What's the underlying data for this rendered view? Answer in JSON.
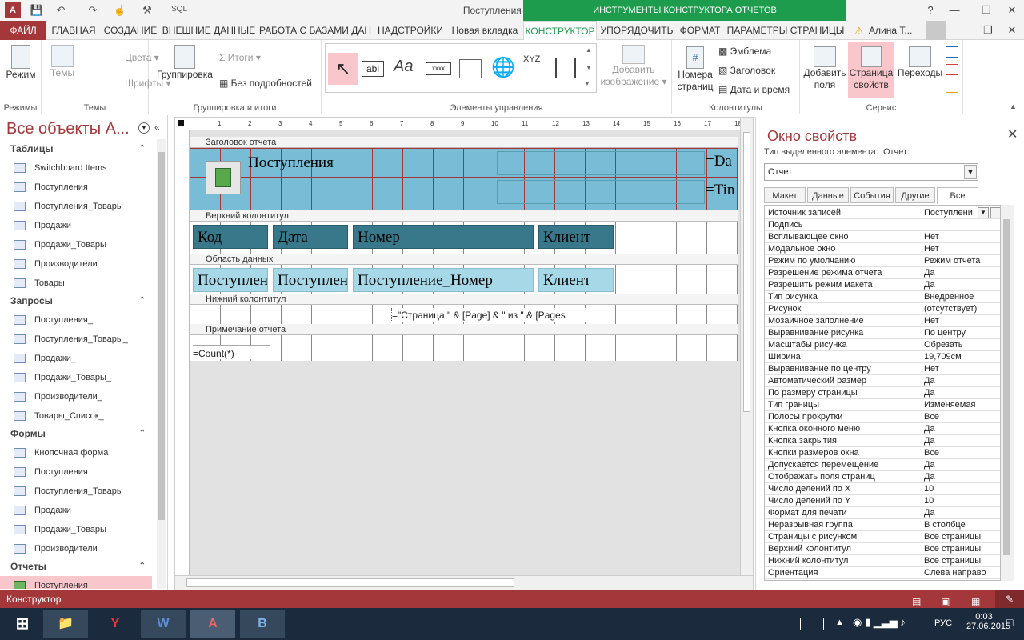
{
  "app": {
    "title": "Поступления - Access",
    "context_group": "ИНСТРУМЕНТЫ КОНСТРУКТОРА ОТЧЕТОВ",
    "qat_sql": "SQL",
    "user": "Алина Т..."
  },
  "tabs": [
    {
      "label": "ФАЙЛ"
    },
    {
      "label": "ГЛАВНАЯ"
    },
    {
      "label": "СОЗДАНИЕ"
    },
    {
      "label": "ВНЕШНИЕ ДАННЫЕ"
    },
    {
      "label": "РАБОТА С БАЗАМИ ДАН"
    },
    {
      "label": "НАДСТРОЙКИ"
    },
    {
      "label": "Новая вкладка"
    },
    {
      "label": "КОНСТРУКТОР"
    },
    {
      "label": "УПОРЯДОЧИТЬ"
    },
    {
      "label": "ФОРМАТ"
    },
    {
      "label": "ПАРАМЕТРЫ СТРАНИЦЫ"
    }
  ],
  "ribbon": {
    "groups": {
      "views": "Режимы",
      "themes": "Темы",
      "grouping": "Группировка и итоги",
      "controls": "Элементы управления",
      "headers": "Колонтитулы",
      "tools": "Сервис"
    },
    "view": "Режим",
    "themes": "Темы",
    "colors": "Цвета",
    "fonts": "Шрифты",
    "grouping": "Группировка",
    "totals": "Итоги",
    "no_details": "Без подробностей",
    "add_image": [
      "Добавить",
      "изображение"
    ],
    "page_numbers": [
      "Номера",
      "страниц"
    ],
    "logo": "Эмблема",
    "title": "Заголовок",
    "datetime": "Дата и время",
    "add_fields": [
      "Добавить",
      "поля"
    ],
    "property_sheet": [
      "Страница",
      "свойств"
    ],
    "transitions": "Переходы",
    "ctrl_label": "XYZ",
    "ctrl_text": "abl",
    "ctrl_aa": "Aa",
    "ctrl_xxxx": "xxxx"
  },
  "nav": {
    "title": "Все объекты А...",
    "sections": [
      {
        "name": "Таблицы",
        "items": [
          "Switchboard Items",
          "Поступления",
          "Поступления_Товары",
          "Продажи",
          "Продажи_Товары",
          "Производители",
          "Товары"
        ]
      },
      {
        "name": "Запросы",
        "items": [
          "Поступления_",
          "Поступления_Товары_",
          "Продажи_",
          "Продажи_Товары_",
          "Производители_",
          "Товары_Список_"
        ]
      },
      {
        "name": "Формы",
        "items": [
          "Кнопочная форма",
          "Поступления",
          "Поступления_Товары",
          "Продажи",
          "Продажи_Товары",
          "Производители"
        ]
      },
      {
        "name": "Отчеты",
        "items": [
          "Поступления"
        ]
      }
    ]
  },
  "designer": {
    "ruler_marks": [
      "1",
      "2",
      "3",
      "4",
      "5",
      "6",
      "7",
      "8",
      "9",
      "10",
      "11",
      "12",
      "13",
      "14",
      "15",
      "16",
      "17",
      "18"
    ],
    "bands": [
      "Заголовок отчета",
      "Верхний колонтитул",
      "Область данных",
      "Нижний колонтитул",
      "Примечание отчета"
    ],
    "report_title": "Поступления",
    "date_expr": "=Da",
    "time_expr": "=Tin",
    "headers": [
      "Код",
      "Дата",
      "Номер",
      "Клиент"
    ],
    "data_fields": [
      "Поступлен",
      "Поступлен",
      "Поступление_Номер",
      "Клиент"
    ],
    "page_expr": "=\"Страница \" & [Page] & \" из \" & [Pages",
    "count_expr": "=Count(*)"
  },
  "props": {
    "title": "Окно свойств",
    "selection_type_label": "Тип выделенного элемента:",
    "selection_type": "Отчет",
    "selected": "Отчет",
    "tabs": [
      "Макет",
      "Данные",
      "События",
      "Другие",
      "Все"
    ],
    "rows": [
      [
        "Источник записей",
        "Поступлени"
      ],
      [
        "Подпись",
        ""
      ],
      [
        "Всплывающее окно",
        "Нет"
      ],
      [
        "Модальное окно",
        "Нет"
      ],
      [
        "Режим по умолчанию",
        "Режим отчета"
      ],
      [
        "Разрешение режима отчета",
        "Да"
      ],
      [
        "Разрешить режим макета",
        "Да"
      ],
      [
        "Тип рисунка",
        "Внедренное"
      ],
      [
        "Рисунок",
        "(отсутствует)"
      ],
      [
        "Мозаичное заполнение",
        "Нет"
      ],
      [
        "Выравнивание рисунка",
        "По центру"
      ],
      [
        "Масштабы рисунка",
        "Обрезать"
      ],
      [
        "Ширина",
        "19,709см"
      ],
      [
        "Выравнивание по центру",
        "Нет"
      ],
      [
        "Автоматический размер",
        "Да"
      ],
      [
        "По размеру страницы",
        "Да"
      ],
      [
        "Тип границы",
        "Изменяемая"
      ],
      [
        "Полосы прокрутки",
        "Все"
      ],
      [
        "Кнопка оконного меню",
        "Да"
      ],
      [
        "Кнопка закрытия",
        "Да"
      ],
      [
        "Кнопки размеров окна",
        "Все"
      ],
      [
        "Допускается перемещение",
        "Да"
      ],
      [
        "Отображать поля страниц",
        "Да"
      ],
      [
        "Число делений по X",
        "10"
      ],
      [
        "Число делений по Y",
        "10"
      ],
      [
        "Формат для печати",
        "Да"
      ],
      [
        "Неразрывная группа",
        "В столбце"
      ],
      [
        "Страницы с рисунком",
        "Все страницы"
      ],
      [
        "Верхний колонтитул",
        "Все страницы"
      ],
      [
        "Нижний колонтитул",
        "Все страницы"
      ],
      [
        "Ориентация",
        "Слева направо"
      ]
    ]
  },
  "status": {
    "text": "Конструктор"
  },
  "taskbar": {
    "lang": "РУС",
    "time": "0:03",
    "date": "27.06.2015"
  }
}
